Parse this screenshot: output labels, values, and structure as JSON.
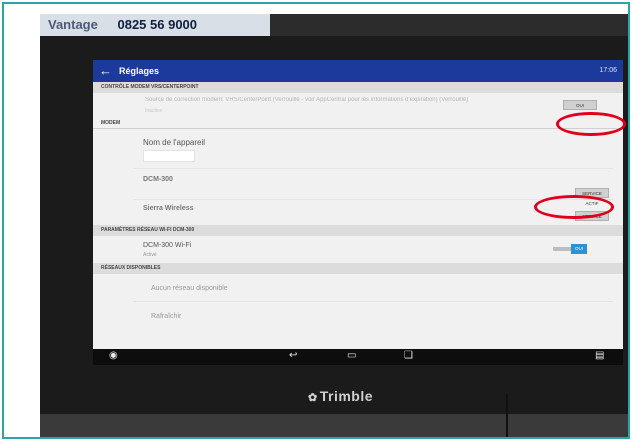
{
  "sticker": {
    "brand": "Vantage",
    "phone": "0825 56 9000"
  },
  "appbar": {
    "back_icon": "arrow-left-icon",
    "title": "Réglages",
    "time": "17:06"
  },
  "sections": [
    {
      "label": "CONTRÔLE MODEM VRS/CENTERPOINT"
    },
    {
      "label": "MODEM"
    },
    {
      "label": "PARAMÈTRES RÉSEAU WI-FI DCM-300"
    },
    {
      "label": "RÉSEAUX DISPONIBLES"
    }
  ],
  "vrs": {
    "description": "Source de correction modem: VRS/CenterPoint (Verrouillé - voir AppCentral pour les informations d'expiration) (Verrouillé)",
    "sub": "Inactive",
    "button": "OUI"
  },
  "modem": {
    "device_name_label": "Nom de l'appareil",
    "dcm_label": "DCM-300",
    "dcm_button": "SERVICE ACTIF",
    "sierra_label": "Sierra Wireless",
    "sierra_button": "SERVICE ACTIF"
  },
  "wifi": {
    "label": "DCM-300 Wi-Fi",
    "sub": "Activé",
    "toggle": "OUI"
  },
  "networks": {
    "none_label": "Aucun réseau disponible",
    "refresh_label": "Rafraîchir"
  },
  "brand": {
    "name": "Trimble"
  },
  "colors": {
    "appbar": "#1c3a9b",
    "accent": "#2a92d6",
    "ring": "#e1001a",
    "frame": "#2aa7a0"
  }
}
